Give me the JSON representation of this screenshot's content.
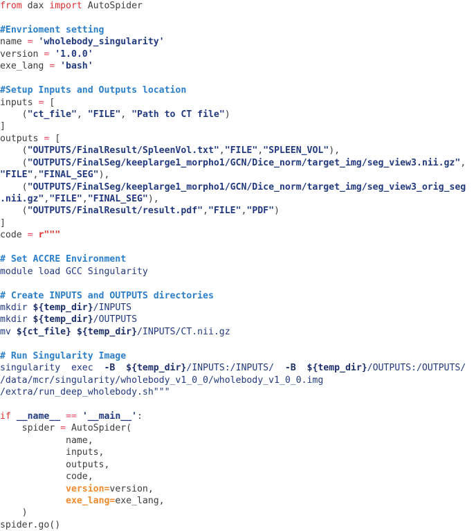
{
  "document": {
    "kind": "python-source-listing",
    "language": "Python",
    "background_color": "#ffffff",
    "default_text_color": "#3c3c3c",
    "palette": {
      "keyword": "#e02f2f",
      "operator": "#e8485c",
      "comment": "#2b7fc9",
      "string": "#22397f",
      "shell_variable": "#1d2f6b",
      "keyword_argument": "#ee8b2d",
      "plain": "#3c3c3c"
    }
  },
  "lines": [
    {
      "id": "l1",
      "tokens": [
        {
          "t": "from",
          "c": "keyword"
        },
        {
          "t": " dax ",
          "c": "plain"
        },
        {
          "t": "import",
          "c": "keyword"
        },
        {
          "t": " AutoSpider",
          "c": "plain"
        }
      ]
    },
    {
      "id": "l2",
      "tokens": []
    },
    {
      "id": "l3",
      "tokens": [
        {
          "t": "#Envrioment setting",
          "c": "comment"
        }
      ]
    },
    {
      "id": "l4",
      "tokens": [
        {
          "t": "name ",
          "c": "plain"
        },
        {
          "t": "=",
          "c": "operator"
        },
        {
          "t": " ",
          "c": "plain"
        },
        {
          "t": "'wholebody_singularity'",
          "c": "string"
        }
      ]
    },
    {
      "id": "l5",
      "tokens": [
        {
          "t": "version ",
          "c": "plain"
        },
        {
          "t": "=",
          "c": "operator"
        },
        {
          "t": " ",
          "c": "plain"
        },
        {
          "t": "'1.0.0'",
          "c": "string"
        }
      ]
    },
    {
      "id": "l6",
      "tokens": [
        {
          "t": "exe_lang ",
          "c": "plain"
        },
        {
          "t": "=",
          "c": "operator"
        },
        {
          "t": " ",
          "c": "plain"
        },
        {
          "t": "'bash'",
          "c": "string"
        }
      ]
    },
    {
      "id": "l7",
      "tokens": []
    },
    {
      "id": "l8",
      "tokens": [
        {
          "t": "#Setup Inputs and Outputs location",
          "c": "comment"
        }
      ]
    },
    {
      "id": "l9",
      "tokens": [
        {
          "t": "inputs ",
          "c": "plain"
        },
        {
          "t": "=",
          "c": "operator"
        },
        {
          "t": " [",
          "c": "plain"
        }
      ]
    },
    {
      "id": "l10",
      "tokens": [
        {
          "t": "    (",
          "c": "plain"
        },
        {
          "t": "\"ct_file\"",
          "c": "string"
        },
        {
          "t": ", ",
          "c": "plain"
        },
        {
          "t": "\"FILE\"",
          "c": "string"
        },
        {
          "t": ", ",
          "c": "plain"
        },
        {
          "t": "\"Path to CT file\"",
          "c": "string"
        },
        {
          "t": ")",
          "c": "plain"
        }
      ]
    },
    {
      "id": "l11",
      "tokens": [
        {
          "t": "]",
          "c": "plain"
        }
      ]
    },
    {
      "id": "l12",
      "tokens": [
        {
          "t": "outputs ",
          "c": "plain"
        },
        {
          "t": "=",
          "c": "operator"
        },
        {
          "t": " [",
          "c": "plain"
        }
      ]
    },
    {
      "id": "l13",
      "tokens": [
        {
          "t": "    (",
          "c": "plain"
        },
        {
          "t": "\"OUTPUTS/FinalResult/SpleenVol.txt\"",
          "c": "string"
        },
        {
          "t": ",",
          "c": "plain"
        },
        {
          "t": "\"FILE\"",
          "c": "string"
        },
        {
          "t": ",",
          "c": "plain"
        },
        {
          "t": "\"SPLEEN_VOL\"",
          "c": "string"
        },
        {
          "t": "),",
          "c": "plain"
        }
      ]
    },
    {
      "id": "l14",
      "tokens": [
        {
          "t": "    (",
          "c": "plain"
        },
        {
          "t": "\"OUTPUTS/FinalSeg/keeplarge1_morpho1/GCN/Dice_norm/target_img/seg_view3.nii.gz\"",
          "c": "string"
        },
        {
          "t": ",",
          "c": "plain"
        }
      ]
    },
    {
      "id": "l15",
      "tokens": [
        {
          "t": "\"FILE\"",
          "c": "string"
        },
        {
          "t": ",",
          "c": "plain"
        },
        {
          "t": "\"FINAL_SEG\"",
          "c": "string"
        },
        {
          "t": "),",
          "c": "plain"
        }
      ]
    },
    {
      "id": "l16",
      "tokens": [
        {
          "t": "    (",
          "c": "plain"
        },
        {
          "t": "\"OUTPUTS/FinalSeg/keeplarge1_morpho1/GCN/Dice_norm/target_img/seg_view3_orig_seg",
          "c": "string"
        }
      ]
    },
    {
      "id": "l17",
      "tokens": [
        {
          "t": ".nii.gz\"",
          "c": "string"
        },
        {
          "t": ",",
          "c": "plain"
        },
        {
          "t": "\"FILE\"",
          "c": "string"
        },
        {
          "t": ",",
          "c": "plain"
        },
        {
          "t": "\"FINAL_SEG\"",
          "c": "string"
        },
        {
          "t": "),",
          "c": "plain"
        }
      ]
    },
    {
      "id": "l18",
      "tokens": [
        {
          "t": "    (",
          "c": "plain"
        },
        {
          "t": "\"OUTPUTS/FinalResult/result.pdf\"",
          "c": "string"
        },
        {
          "t": ",",
          "c": "plain"
        },
        {
          "t": "\"FILE\"",
          "c": "string"
        },
        {
          "t": ",",
          "c": "plain"
        },
        {
          "t": "\"PDF\"",
          "c": "string"
        },
        {
          "t": ")",
          "c": "plain"
        }
      ]
    },
    {
      "id": "l19",
      "tokens": [
        {
          "t": "]",
          "c": "plain"
        }
      ]
    },
    {
      "id": "l20",
      "tokens": [
        {
          "t": "code ",
          "c": "plain"
        },
        {
          "t": "=",
          "c": "operator"
        },
        {
          "t": " ",
          "c": "plain"
        },
        {
          "t": "r\"\"\"",
          "c": "rawprefix"
        }
      ]
    },
    {
      "id": "l21",
      "tokens": []
    },
    {
      "id": "l22",
      "tokens": [
        {
          "t": "# Set ACCRE Environment",
          "c": "comment"
        }
      ]
    },
    {
      "id": "l23",
      "tokens": [
        {
          "t": "module load GCC Singularity",
          "c": "shell"
        }
      ]
    },
    {
      "id": "l24",
      "tokens": []
    },
    {
      "id": "l25",
      "tokens": [
        {
          "t": "# Create INPUTS and OUTPUTS directories",
          "c": "comment"
        }
      ]
    },
    {
      "id": "l26",
      "tokens": [
        {
          "t": "mkdir ",
          "c": "shell"
        },
        {
          "t": "${temp_dir}",
          "c": "shellvar"
        },
        {
          "t": "/INPUTS",
          "c": "shell"
        }
      ]
    },
    {
      "id": "l27",
      "tokens": [
        {
          "t": "mkdir ",
          "c": "shell"
        },
        {
          "t": "${temp_dir}",
          "c": "shellvar"
        },
        {
          "t": "/OUTPUTS",
          "c": "shell"
        }
      ]
    },
    {
      "id": "l28",
      "tokens": [
        {
          "t": "mv ",
          "c": "shell"
        },
        {
          "t": "${ct_file}",
          "c": "shellvar"
        },
        {
          "t": " ",
          "c": "shell"
        },
        {
          "t": "${temp_dir}",
          "c": "shellvar"
        },
        {
          "t": "/INPUTS/CT.nii.gz",
          "c": "shell"
        }
      ]
    },
    {
      "id": "l29",
      "tokens": []
    },
    {
      "id": "l30",
      "tokens": [
        {
          "t": "# Run Singularity Image",
          "c": "comment"
        }
      ]
    },
    {
      "id": "l31",
      "tokens": [
        {
          "t": "singularity  exec  ",
          "c": "shell"
        },
        {
          "t": "-B",
          "c": "shellvar"
        },
        {
          "t": "  ",
          "c": "shell"
        },
        {
          "t": "${temp_dir}",
          "c": "shellvar"
        },
        {
          "t": "/INPUTS:/INPUTS/  ",
          "c": "shell"
        },
        {
          "t": "-B",
          "c": "shellvar"
        },
        {
          "t": "  ",
          "c": "shell"
        },
        {
          "t": "${temp_dir}",
          "c": "shellvar"
        },
        {
          "t": "/OUTPUTS:/OUTPUTS/",
          "c": "shell"
        }
      ]
    },
    {
      "id": "l32",
      "tokens": [
        {
          "t": "/data/mcr/singularity/wholebody_v1_0_0/wholebody_v1_0_0.img",
          "c": "shell"
        }
      ]
    },
    {
      "id": "l33",
      "tokens": [
        {
          "t": "/extra/run_deep_wholebody.sh\"\"\"",
          "c": "shell"
        }
      ]
    },
    {
      "id": "l34",
      "tokens": []
    },
    {
      "id": "l35",
      "tokens": [
        {
          "t": "if",
          "c": "keyword"
        },
        {
          "t": " ",
          "c": "plain"
        },
        {
          "t": "__name__",
          "c": "dunder"
        },
        {
          "t": " ",
          "c": "plain"
        },
        {
          "t": "==",
          "c": "operator"
        },
        {
          "t": " ",
          "c": "plain"
        },
        {
          "t": "'__main__'",
          "c": "string"
        },
        {
          "t": ":",
          "c": "plain"
        }
      ]
    },
    {
      "id": "l36",
      "tokens": [
        {
          "t": "    spider ",
          "c": "plain"
        },
        {
          "t": "=",
          "c": "operator"
        },
        {
          "t": " AutoSpider(",
          "c": "plain"
        }
      ]
    },
    {
      "id": "l37",
      "tokens": [
        {
          "t": "            name,",
          "c": "plain"
        }
      ]
    },
    {
      "id": "l38",
      "tokens": [
        {
          "t": "            inputs,",
          "c": "plain"
        }
      ]
    },
    {
      "id": "l39",
      "tokens": [
        {
          "t": "            outputs,",
          "c": "plain"
        }
      ]
    },
    {
      "id": "l40",
      "tokens": [
        {
          "t": "            code,",
          "c": "plain"
        }
      ]
    },
    {
      "id": "l41",
      "tokens": [
        {
          "t": "            ",
          "c": "plain"
        },
        {
          "t": "version=",
          "c": "kwarg"
        },
        {
          "t": "version,",
          "c": "plain"
        }
      ]
    },
    {
      "id": "l42",
      "tokens": [
        {
          "t": "            ",
          "c": "plain"
        },
        {
          "t": "exe_lang=",
          "c": "kwarg"
        },
        {
          "t": "exe_lang,",
          "c": "plain"
        }
      ]
    },
    {
      "id": "l43",
      "tokens": [
        {
          "t": "    )",
          "c": "plain"
        }
      ]
    },
    {
      "id": "l44",
      "tokens": [
        {
          "t": "spider.go()",
          "c": "plain"
        }
      ]
    }
  ]
}
